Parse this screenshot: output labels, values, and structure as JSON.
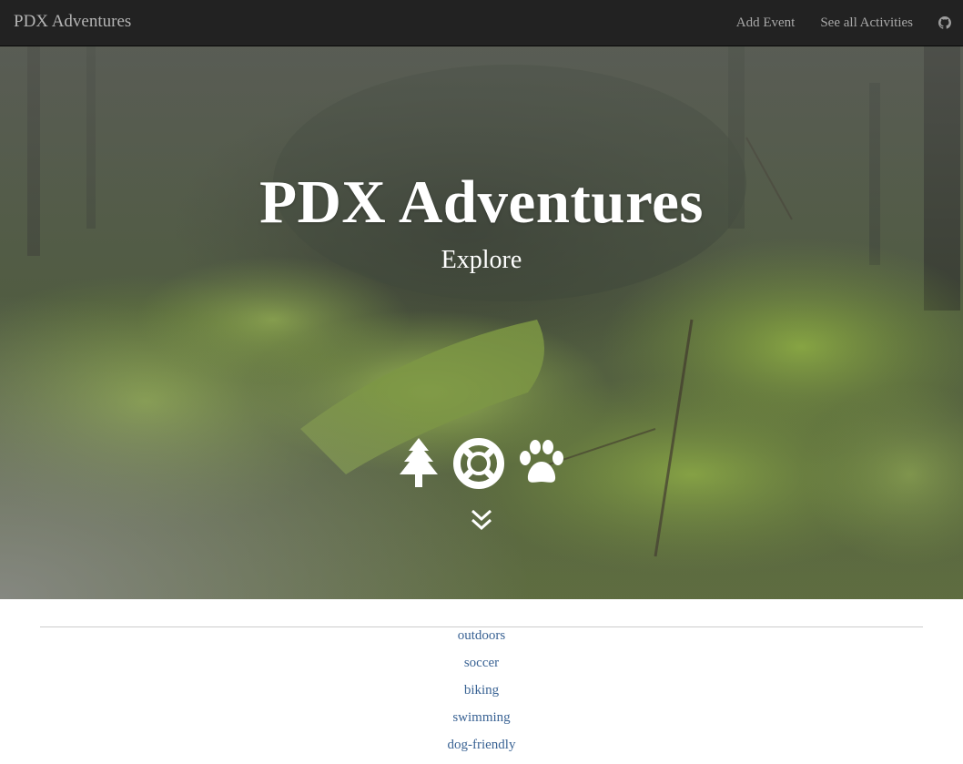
{
  "navbar": {
    "brand": "PDX Adventures",
    "links": [
      "Add Event",
      "See all Activities"
    ],
    "github_icon": "github-icon"
  },
  "hero": {
    "title": "PDX Adventures",
    "subtitle": "Explore",
    "icons": [
      "tree-icon",
      "life-ring-icon",
      "paw-icon"
    ],
    "scroll_icon": "double-chevron-down-icon"
  },
  "tags": [
    "outdoors",
    "soccer",
    "biking",
    "swimming",
    "dog-friendly"
  ],
  "colors": {
    "navbar_bg": "#222222",
    "link": "#3a6394",
    "hero_text": "#ffffff"
  }
}
